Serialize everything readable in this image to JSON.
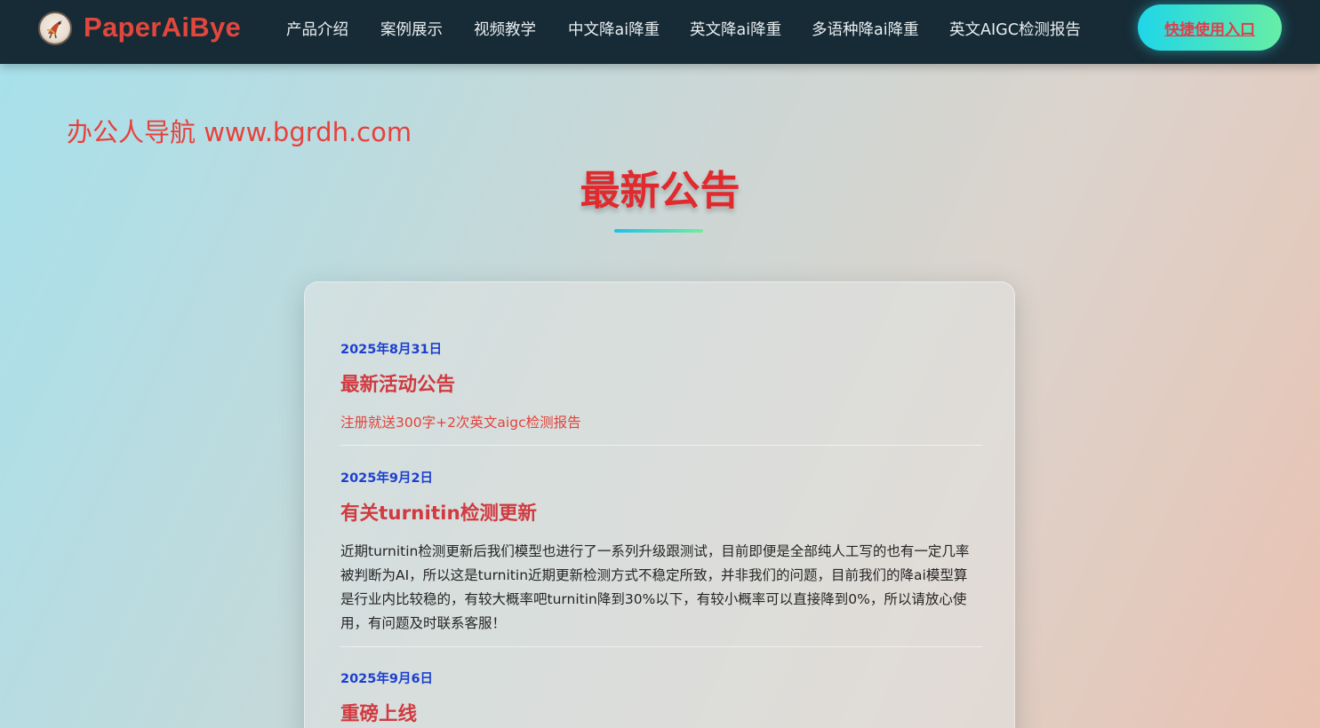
{
  "nav": {
    "brand": "PaperAiBye",
    "items": [
      {
        "label": "产品介绍"
      },
      {
        "label": "案例展示"
      },
      {
        "label": "视频教学"
      },
      {
        "label": "中文降ai降重"
      },
      {
        "label": "英文降ai降重"
      },
      {
        "label": "多语种降ai降重"
      },
      {
        "label": "英文AIGC检测报告"
      }
    ],
    "cta_label": "快捷使用入口"
  },
  "watermark": "办公人导航 www.bgrdh.com",
  "section": {
    "title": "最新公告"
  },
  "notices": [
    {
      "date": "2025年8月31日",
      "title": "最新活动公告",
      "body": "注册就送300字+2次英文aigc检测报告"
    },
    {
      "date": "2025年9月2日",
      "title": "有关turnitin检测更新",
      "body": "近期turnitin检测更新后我们模型也进行了一系列升级跟测试，目前即便是全部纯人工写的也有一定几率被判断为AI，所以这是turnitin近期更新检测方式不稳定所致，并非我们的问题，目前我们的降ai模型算是行业内比较稳的，有较大概率吧turnitin降到30%以下，有较小概率可以直接降到0%，所以请放心使用，有问题及时联系客服！"
    },
    {
      "date": "2025年9月6日",
      "title": "重磅上线",
      "body": ""
    }
  ],
  "colors": {
    "nav_bg": "#172b36",
    "brand": "#e2473d",
    "accent_start": "#1fd6e8",
    "accent_end": "#66eea6",
    "title_red": "#e02a2e",
    "date_blue": "#1d3fd0"
  },
  "icons": {
    "logo": "bird-logo-icon"
  }
}
